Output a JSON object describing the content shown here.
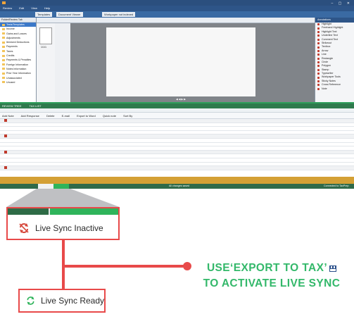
{
  "app": {
    "menu": [
      "Review",
      "Edit",
      "View",
      "Help"
    ],
    "tabs": [
      "Templates",
      "Document Viewer",
      "Workpaper not indexed"
    ]
  },
  "document": {
    "thumbnail_label": "1/1/1"
  },
  "right_panel": {
    "header": "Annotations",
    "items": [
      "Highlight",
      "Freehand Highlight",
      "Highlight Text",
      "Underline Text",
      "Comment Text",
      "Strikeout",
      "Textbox",
      "Arrow",
      "Line",
      "Rectangle",
      "Circle",
      "Polygon",
      "Stamp",
      "Typewriter",
      "Workpaper Tools",
      "Sticky Notes",
      "Cross Reference",
      "Note"
    ]
  },
  "folders": {
    "header": "Folder/Review Tab",
    "items": [
      "Tests/Templates",
      "Income",
      "Gains and Losses",
      "Adjustments",
      "Itemized Deductions",
      "Payments",
      "Taxes",
      "Credits",
      "Payments & Penalties",
      "Foreign Information",
      "Notes Information",
      "Prior Year Information",
      "Unassociated",
      "Unused"
    ]
  },
  "workflow": {
    "tabs": [
      "REVIEW TREE",
      "TAX LIST"
    ],
    "actions": [
      "Add Note",
      "Add Response",
      "Delete",
      "E-mail",
      "Export to Word",
      "Quick note",
      "Sort By"
    ]
  },
  "status": {
    "changes": "All changes saved",
    "connection": "Connected to TaxPrep"
  },
  "annotations": {
    "inactive_label": "Live Sync Inactive",
    "ready_label": "Live Sync Ready",
    "tip_line1": "USE‘EXPORT TO TAX’",
    "tip_line2": "TO ACTIVATE LIVE SYNC"
  },
  "colors": {
    "accent_green": "#33b86a",
    "callout_red": "#e84a4a",
    "inactive_red": "#d6493d",
    "ready_green": "#2fb45b"
  },
  "icons": [
    "sync-inactive-icon",
    "sync-ready-icon",
    "export-to-tax-icon"
  ]
}
